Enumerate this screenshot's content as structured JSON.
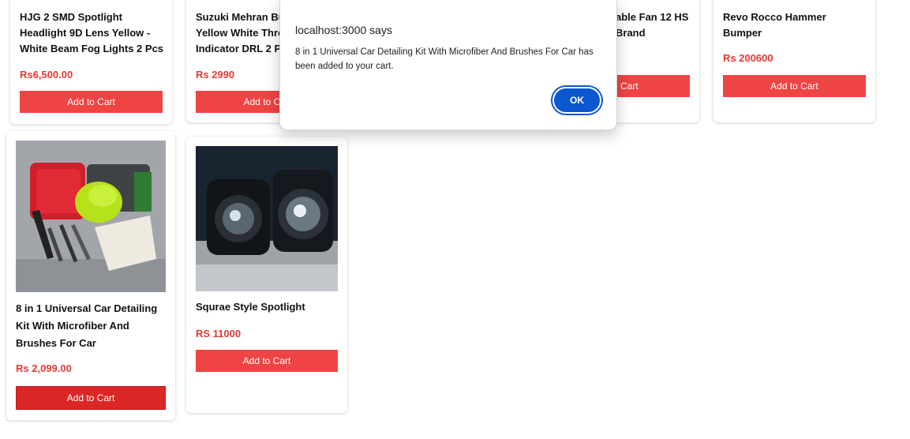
{
  "products_top": [
    {
      "title": "HJG 2 SMD Spotlight Headlight 9D Lens Yellow - White Beam Fog Lights 2 Pcs",
      "price": "Rs6,500.00",
      "button": "Add to Cart"
    },
    {
      "title": "Suzuki Mehran Bu Yellow White Thro Indicator DRL 2 P",
      "price": "Rs 2990",
      "button": "Add to Ca"
    },
    {
      "title": "able Fan 12 HS Brand",
      "button": "o Cart"
    },
    {
      "title": "Revo Rocco Hammer Bumper",
      "price": "Rs 200600",
      "button": "Add to Cart"
    }
  ],
  "products_bottom": [
    {
      "title": "8 in 1 Universal Car Detailing Kit With Microfiber And Brushes For Car",
      "price": "Rs 2,099.00",
      "button": "Add to Cart",
      "image": "car-detailing-kit-image"
    },
    {
      "title": "Squrae Style Spotlight",
      "price": "RS 11000",
      "button": "Add to Cart",
      "image": "spotlight-image"
    }
  ],
  "dialog": {
    "title": "localhost:3000 says",
    "message": "8 in 1 Universal Car Detailing Kit With Microfiber And Brushes For Car has been added to your cart.",
    "ok_label": "OK"
  },
  "colors": {
    "accent": "#ef4444",
    "price": "#e53935",
    "dialog_button": "#0b57d0"
  }
}
